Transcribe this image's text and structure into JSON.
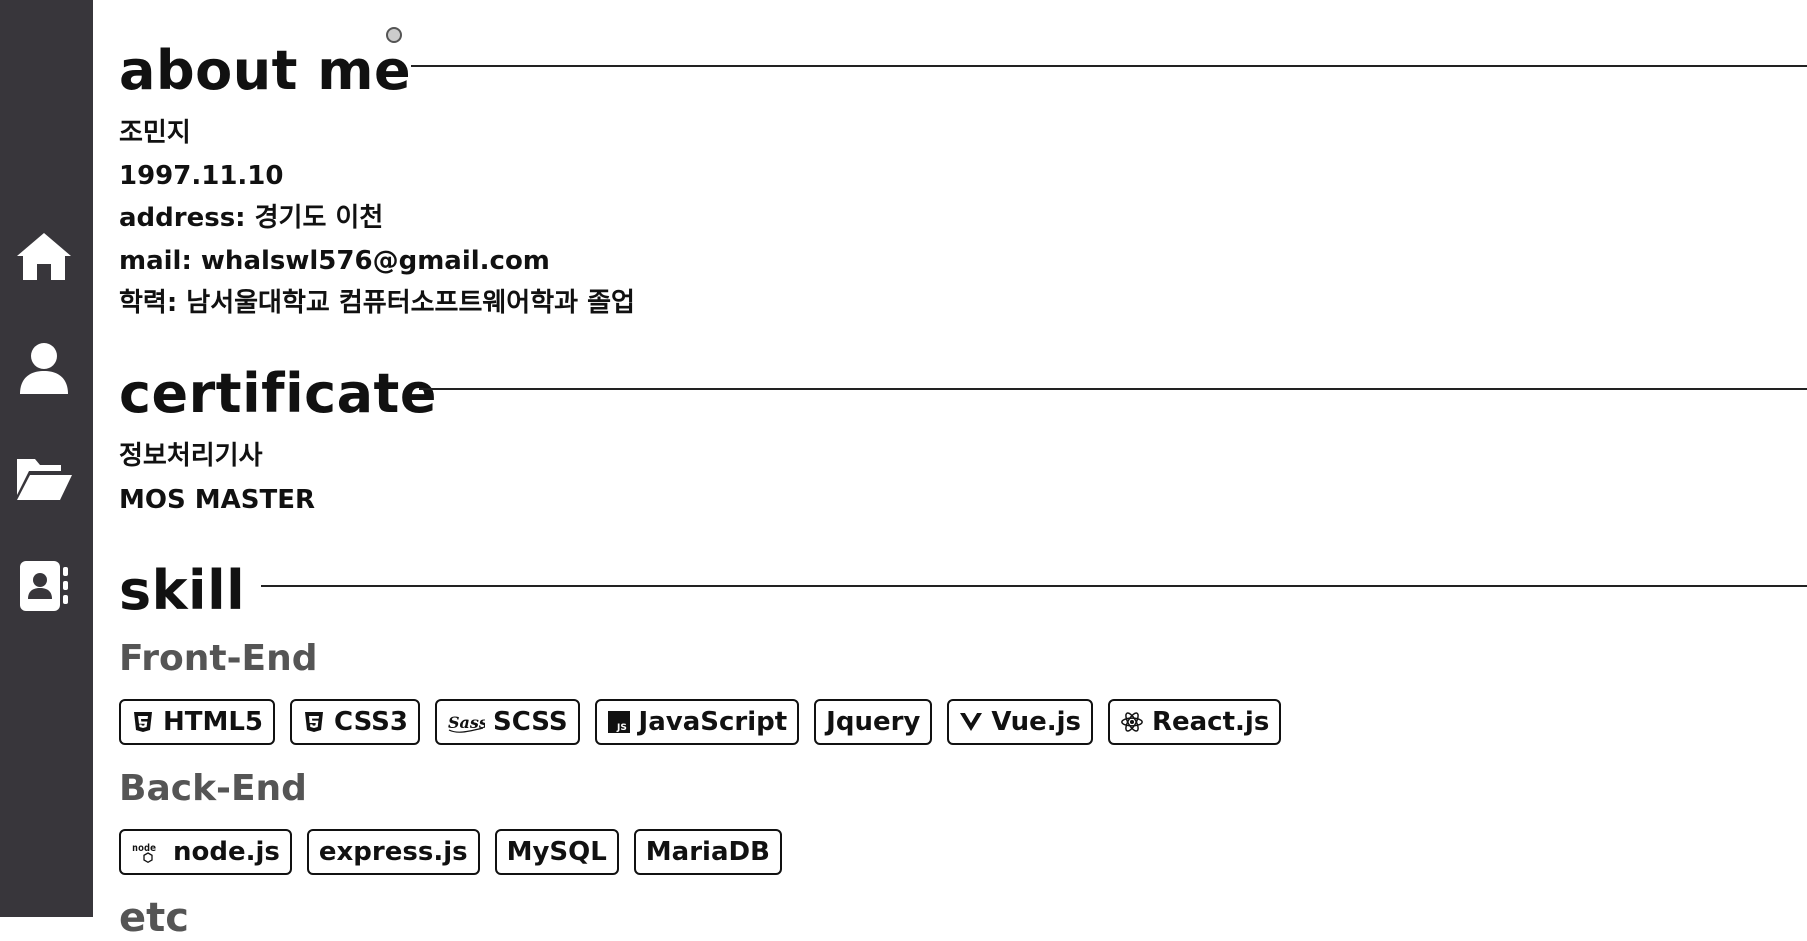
{
  "sidebar": {
    "items": [
      {
        "icon": "home-icon"
      },
      {
        "icon": "user-icon"
      },
      {
        "icon": "folder-open-icon"
      },
      {
        "icon": "contact-book-icon"
      }
    ]
  },
  "about": {
    "title": "about me",
    "name": "조민지",
    "birth": "1997.11.10",
    "address": "address: 경기도 이천",
    "mail": "mail: whalswl576@gmail.com",
    "education": "학력: 남서울대학교 컴퓨터소프트웨어학과 졸업"
  },
  "certificate": {
    "title": "certificate",
    "items": [
      "정보처리기사",
      "MOS MASTER"
    ]
  },
  "skill": {
    "title": "skill",
    "frontend": {
      "label": "Front-End",
      "items": [
        {
          "label": "HTML5",
          "icon": "html5-icon"
        },
        {
          "label": "CSS3",
          "icon": "css3-icon"
        },
        {
          "label": "SCSS",
          "icon": "sass-icon"
        },
        {
          "label": "JavaScript",
          "icon": "javascript-icon"
        },
        {
          "label": "Jquery",
          "icon": ""
        },
        {
          "label": "Vue.js",
          "icon": "vue-icon"
        },
        {
          "label": "React.js",
          "icon": "react-icon"
        }
      ]
    },
    "backend": {
      "label": "Back-End",
      "items": [
        {
          "label": "node.js",
          "icon": "node-icon"
        },
        {
          "label": "express.js",
          "icon": ""
        },
        {
          "label": "MySQL",
          "icon": ""
        },
        {
          "label": "MariaDB",
          "icon": ""
        }
      ]
    },
    "etc_label": "etc"
  }
}
